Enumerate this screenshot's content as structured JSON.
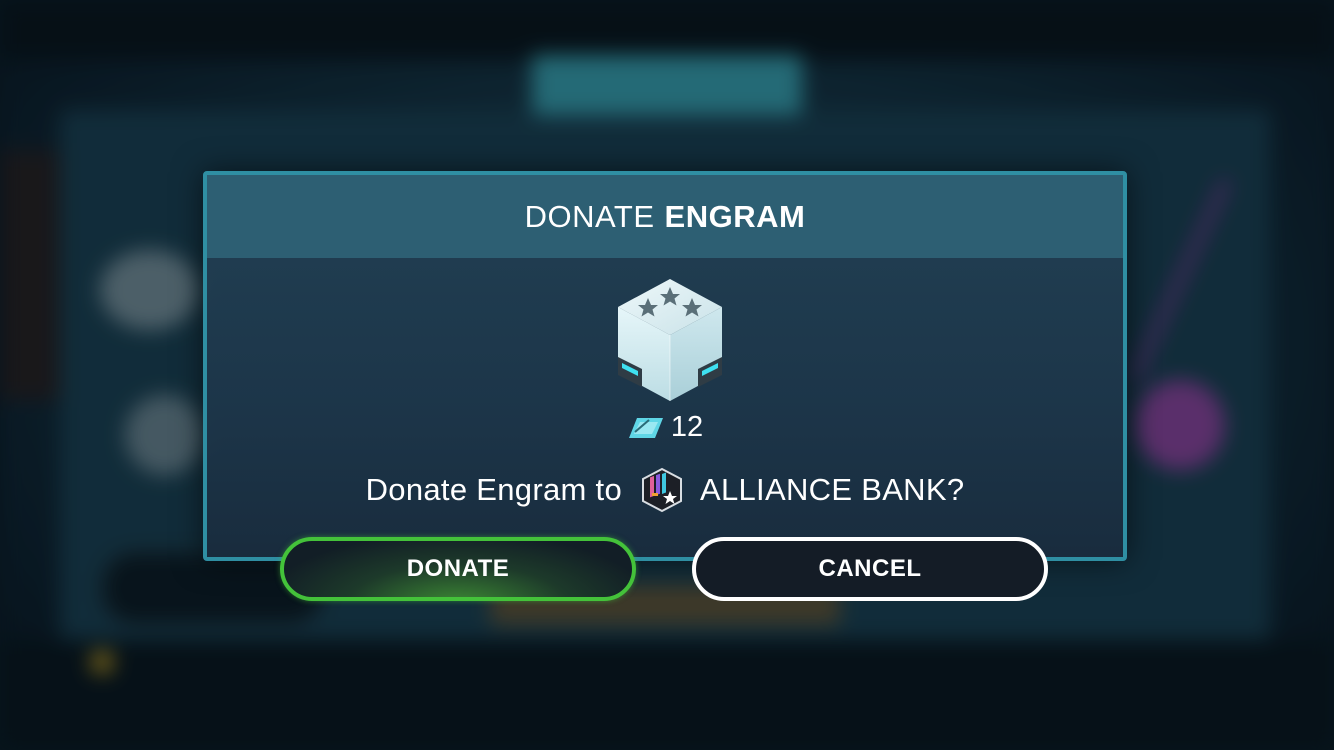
{
  "dialog": {
    "title_prefix": "DONATE",
    "title_bold": "ENGRAM",
    "item_icon": "engram-cube-icon",
    "cost": {
      "icon": "shard-currency-icon",
      "amount": "12"
    },
    "question_prefix": "Donate Engram to",
    "alliance_icon": "alliance-emblem-icon",
    "alliance_name": "ALLIANCE BANK?"
  },
  "buttons": {
    "donate_label": "DONATE",
    "cancel_label": "CANCEL"
  },
  "colors": {
    "accent_border": "#2f8fa3",
    "header_bg": "#2d5f73",
    "donate_green": "#44c23a",
    "cancel_border": "#ffffff",
    "engram_glow": "#3fe0f0"
  }
}
